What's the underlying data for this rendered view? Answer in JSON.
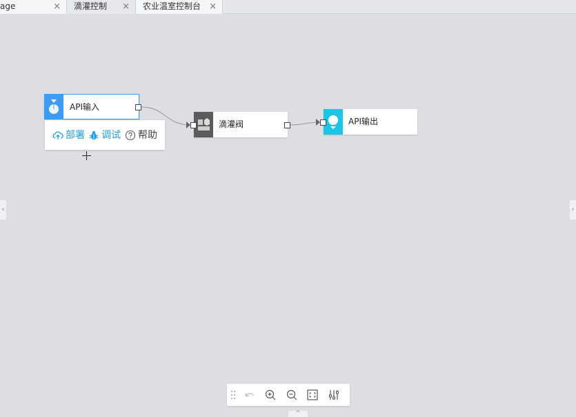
{
  "tabs": [
    {
      "label": "age",
      "close": "×"
    },
    {
      "label": "滴灌控制",
      "close": "×"
    },
    {
      "label": "农业温室控制台",
      "close": "×"
    }
  ],
  "nodes": {
    "api_input": {
      "label": "API输入",
      "color": "#3d9bf2"
    },
    "drip_valve": {
      "label": "滴灌阀",
      "color": "#5b5b5b"
    },
    "api_output": {
      "label": "API输出",
      "color": "#19c6e6"
    }
  },
  "node_menu": {
    "deploy": "部署",
    "debug": "调试",
    "help": "帮助"
  },
  "side": {
    "left": "‹",
    "right": "›",
    "bottom": "^"
  },
  "toolbar": {
    "icons": [
      "drag-handle-icon",
      "undo-icon",
      "zoom-in-icon",
      "zoom-out-icon",
      "fit-view-icon",
      "settings-sliders-icon"
    ]
  }
}
